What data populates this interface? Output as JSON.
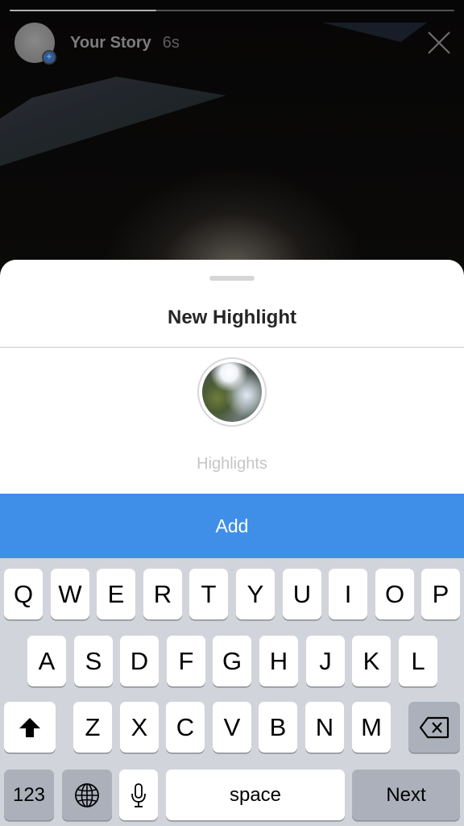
{
  "story": {
    "username": "Your Story",
    "time_ago": "6s",
    "progress_fraction": 0.33,
    "icons": {
      "avatar_badge": "plus-icon",
      "close": "close-icon"
    }
  },
  "sheet": {
    "title": "New Highlight",
    "name_input": {
      "value": "",
      "placeholder": "Highlights"
    },
    "add_button_label": "Add",
    "accent_color": "#3f8fe8"
  },
  "keyboard": {
    "row1": [
      "Q",
      "W",
      "E",
      "R",
      "T",
      "Y",
      "U",
      "I",
      "O",
      "P"
    ],
    "row2": [
      "A",
      "S",
      "D",
      "F",
      "G",
      "H",
      "J",
      "K",
      "L"
    ],
    "row3": [
      "Z",
      "X",
      "C",
      "V",
      "B",
      "N",
      "M"
    ],
    "shift_icon": "shift-icon",
    "delete_icon": "backspace-icon",
    "numbers_label": "123",
    "globe_icon": "globe-icon",
    "mic_icon": "microphone-icon",
    "space_label": "space",
    "return_label": "Next"
  }
}
